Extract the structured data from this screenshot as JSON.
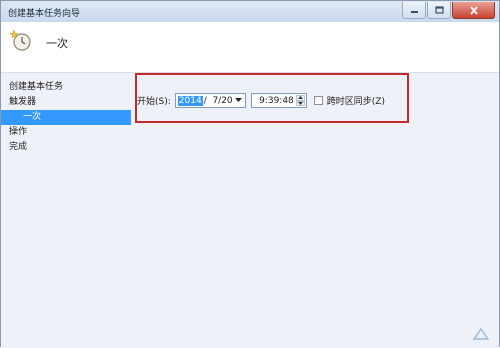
{
  "window": {
    "title": "创建基本任务向导"
  },
  "header": {
    "heading": "一次"
  },
  "sidebar": {
    "items": [
      {
        "label": "创建基本任务"
      },
      {
        "label": "触发器"
      },
      {
        "label": "一次"
      },
      {
        "label": "操作"
      },
      {
        "label": "完成"
      }
    ]
  },
  "start": {
    "label": "开始(S):",
    "date_year": "2014",
    "date_rest": "/  7/20",
    "time": "9:39:48",
    "sync_label": "跨时区同步(Z)",
    "sync_checked": false
  },
  "colors": {
    "selection": "#3399ff",
    "highlight_border": "#c32a2a",
    "sidebar_bg": "#eef2f8"
  }
}
